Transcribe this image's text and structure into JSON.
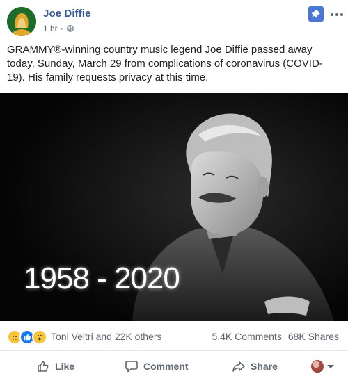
{
  "post": {
    "page_name": "Joe Diffie",
    "time": "1 hr",
    "separator": "·",
    "audience_icon": "globe-icon",
    "text": "GRAMMY®-winning country music legend Joe Diffie passed away today, Sunday, March 29 from complications of coronavirus (COVID-19). His family requests privacy at this time.",
    "image": {
      "years": "1958 - 2020"
    }
  },
  "reactions": {
    "icons": [
      "sad-reaction-icon",
      "like-reaction-icon",
      "wow-reaction-icon"
    ],
    "reactors": "Toni Veltri and 22K others",
    "comments": "5.4K Comments",
    "shares": "68K Shares"
  },
  "actions": {
    "like": "Like",
    "comment": "Comment",
    "share": "Share"
  },
  "colors": {
    "page_name": "#385898",
    "pin": "#4a76d9",
    "secondary_text": "#606770"
  }
}
